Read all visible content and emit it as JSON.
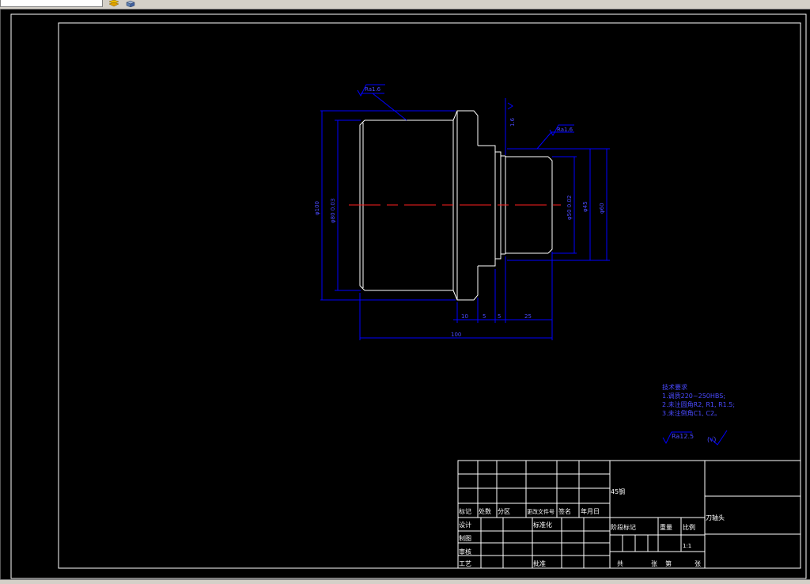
{
  "colors": {
    "background": "#000000",
    "geometry": "#ffffff",
    "dimension": "#0000ff",
    "centerline": "#ff0000",
    "border": "#ffffff"
  },
  "toolbar": {
    "icons": [
      "layer-icon",
      "cube-icon"
    ]
  },
  "drawing": {
    "dimensions": {
      "top_surface": "Ra1.6",
      "mid_surface": "Ra1.6",
      "step_roughness": "1.6",
      "dia_outer": "φ100",
      "dia_bore": "φ80 0.03",
      "dia_hub_inner": "φ50 0.02",
      "dia_hub": "φ45",
      "dia_hub_outer": "φ60",
      "len_a": "10",
      "len_b": "5",
      "len_c": "5",
      "len_d": "25",
      "len_total": "100"
    },
    "notes": {
      "title": "技术要求",
      "line1": "1.调质220~250HBS;",
      "line2": "2.未注圆角R2, R1, R1.5;",
      "line3": "3.未注倒角C1, C2。",
      "roughness_main": "Ra12.5",
      "roughness_rest": "(√)"
    }
  },
  "title_block": {
    "material": "45钢",
    "part_name": "刀轴头",
    "row_labels": {
      "mark": "标记",
      "count": "处数",
      "zone": "分区",
      "change_doc": "更改文件号",
      "signature": "签名",
      "date": "年月日"
    },
    "roles": {
      "design": "设计",
      "standardize": "标准化",
      "drawing": "制图",
      "review": "审核",
      "process": "工艺",
      "approve": "批准"
    },
    "stage_mark": "阶段标记",
    "weight": "重量",
    "scale_label": "比例",
    "scale_value": "1:1",
    "sheets_total": "共",
    "sheets_unit1": "张",
    "sheet_no": "第",
    "sheets_unit2": "张"
  }
}
